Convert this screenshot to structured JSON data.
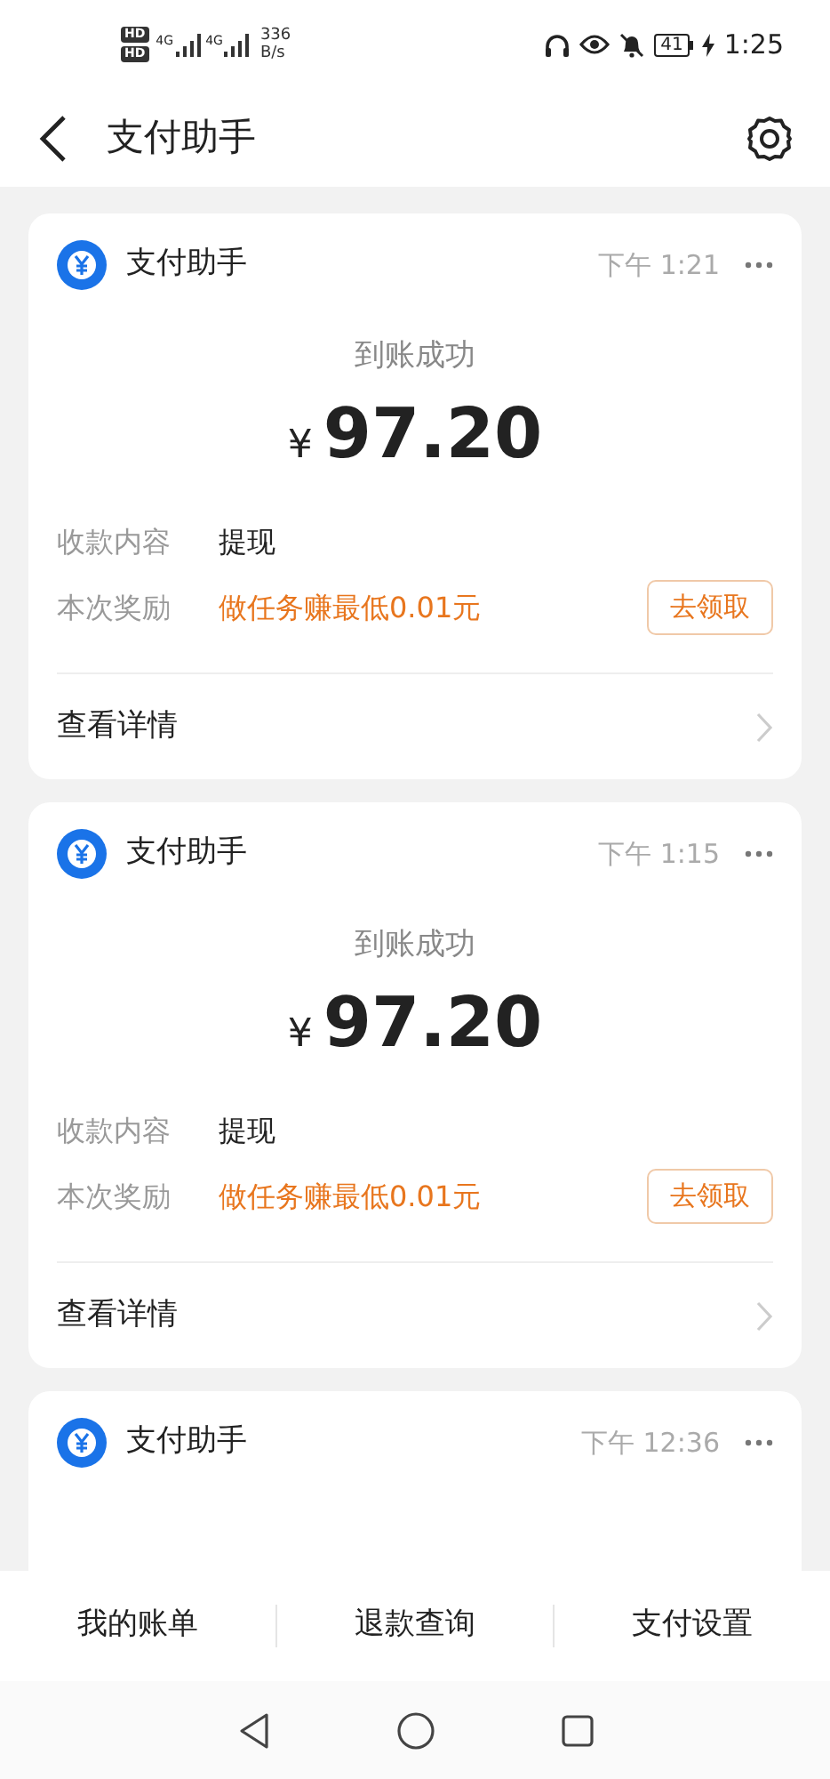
{
  "status_bar": {
    "sims": [
      {
        "badge": "HD",
        "network": "4G"
      },
      {
        "badge": "HD",
        "network": "4G"
      }
    ],
    "speed_value": "336",
    "speed_unit": "B/s",
    "battery": "41",
    "charging": true,
    "time": "1:25"
  },
  "header": {
    "title": "支付助手"
  },
  "cards": [
    {
      "title": "支付助手",
      "time": "下午 1:21",
      "status": "到账成功",
      "currency": "¥",
      "amount": "97.20",
      "rows": [
        {
          "label": "收款内容",
          "value": "提现",
          "kind": "plain"
        },
        {
          "label": "本次奖励",
          "value": "做任务赚最低0.01元",
          "kind": "reward",
          "action": "去领取"
        }
      ],
      "link": "查看详情"
    },
    {
      "title": "支付助手",
      "time": "下午 1:15",
      "status": "到账成功",
      "currency": "¥",
      "amount": "97.20",
      "rows": [
        {
          "label": "收款内容",
          "value": "提现",
          "kind": "plain"
        },
        {
          "label": "本次奖励",
          "value": "做任务赚最低0.01元",
          "kind": "reward",
          "action": "去领取"
        }
      ],
      "link": "查看详情"
    },
    {
      "title": "支付助手",
      "time": "下午 12:36"
    }
  ],
  "bottom_menu": [
    {
      "label": "我的账单"
    },
    {
      "label": "退款查询"
    },
    {
      "label": "支付设置"
    }
  ]
}
